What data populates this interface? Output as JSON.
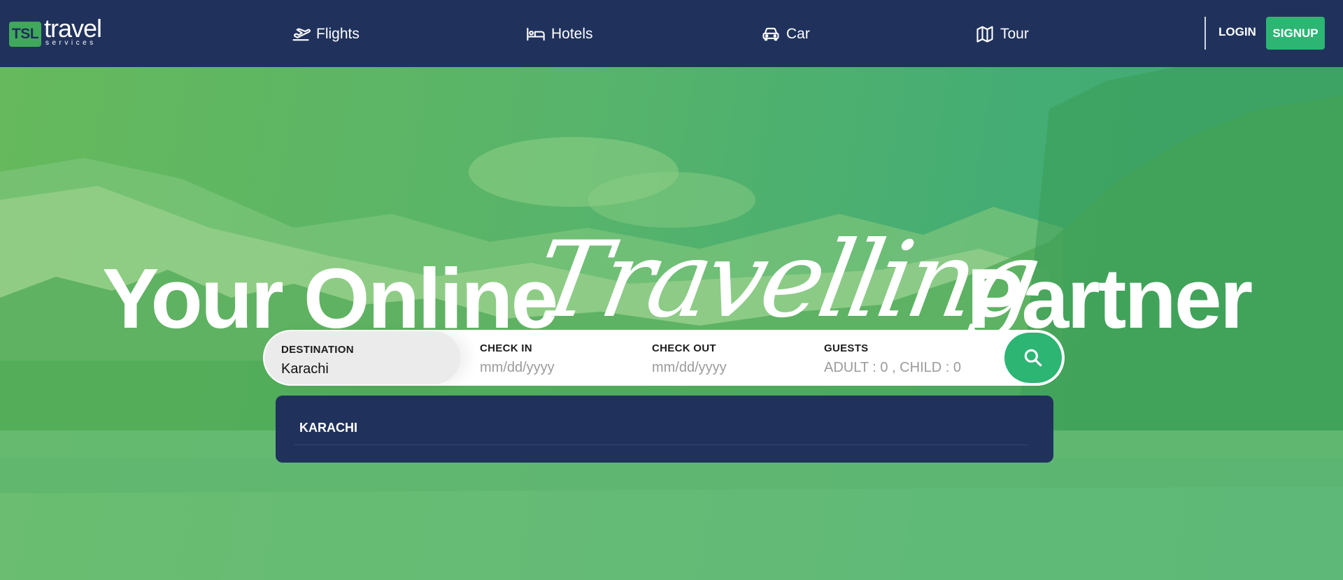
{
  "brand": {
    "badge": "TSL",
    "name": "travel",
    "tagline": "services"
  },
  "nav": {
    "items": [
      {
        "label": "Flights",
        "icon": "plane-departure-icon"
      },
      {
        "label": "Hotels",
        "icon": "bed-icon"
      },
      {
        "label": "Car",
        "icon": "car-icon"
      },
      {
        "label": "Tour",
        "icon": "map-icon"
      }
    ],
    "login": "LOGIN",
    "signup": "SIGNUP"
  },
  "hero": {
    "headline_left": "Your Online",
    "headline_script": "Travelling",
    "headline_right": "Partner"
  },
  "search": {
    "destination": {
      "label": "DESTINATION",
      "value": "Karachi"
    },
    "check_in": {
      "label": "CHECK IN",
      "placeholder": "mm/dd/yyyy"
    },
    "check_out": {
      "label": "CHECK OUT",
      "placeholder": "mm/dd/yyyy"
    },
    "guests": {
      "label": "GUESTS",
      "placeholder": "ADULT : 0 , CHILD : 0"
    },
    "button_icon": "search-icon"
  },
  "suggestions": [
    "KARACHI"
  ],
  "colors": {
    "nav_bg": "#20325c",
    "accent": "#2cb573",
    "hero_tint": "#58b46a"
  }
}
